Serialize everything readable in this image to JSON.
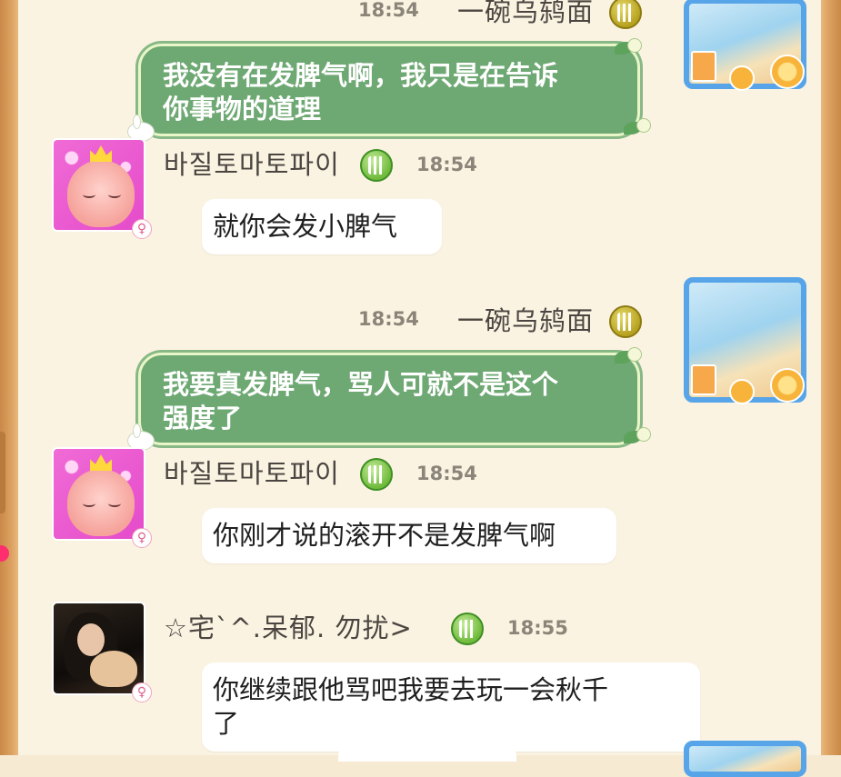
{
  "colors": {
    "sent_bubble": "#6ea873",
    "background": "#fbf3e2",
    "badge_gold": "#c9b634",
    "badge_green": "#6fba3b",
    "notification_dot": "#ff2f6f"
  },
  "messages": [
    {
      "type": "sent",
      "sender": "一碗乌鸫面",
      "time": "18:54",
      "text_lines": [
        "我没有在发脾气啊，我只是在告诉",
        "你事物的道理"
      ]
    },
    {
      "type": "received",
      "sender": "바질토마토파이",
      "time": "18:54",
      "text_lines": [
        "就你会发小脾气"
      ],
      "avatar": "pink-blob-avatar",
      "gender": "♀"
    },
    {
      "type": "sent",
      "sender": "一碗乌鸫面",
      "time": "18:54",
      "text_lines": [
        "我要真发脾气，骂人可就不是这个",
        "强度了"
      ]
    },
    {
      "type": "received",
      "sender": "바질토마토파이",
      "time": "18:54",
      "text_lines": [
        "你刚才说的滚开不是发脾气啊"
      ],
      "avatar": "pink-blob-avatar",
      "gender": "♀"
    },
    {
      "type": "received",
      "sender": "☆宅`^.呆郁. 勿扰>",
      "time": "18:55",
      "text_lines": [
        "你继续跟他骂吧我要去玩一会秋千",
        "了"
      ],
      "avatar": "photo-avatar",
      "gender": "♀"
    }
  ],
  "icons": {
    "level_badge": "level-badge-icon",
    "gender": "female-icon"
  }
}
